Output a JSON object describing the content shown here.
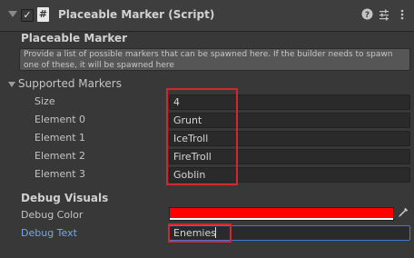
{
  "header": {
    "enabled_check": "✓",
    "script_icon": "#",
    "title": "Placeable Marker (Script)",
    "icons": [
      "help-icon",
      "presets-icon",
      "more-options-icon"
    ]
  },
  "intro": {
    "title": "Placeable Marker",
    "help_text": "Provide a list of possible markers that can be spawned here.  If the builder needs to spawn one of these, it will be spawned here"
  },
  "supported_markers": {
    "label": "Supported Markers",
    "size_label": "Size",
    "size_value": "4",
    "elements": [
      {
        "label": "Element 0",
        "value": "Grunt"
      },
      {
        "label": "Element 1",
        "value": "IceTroll"
      },
      {
        "label": "Element 2",
        "value": "FireTroll"
      },
      {
        "label": "Element 3",
        "value": "Goblin"
      }
    ]
  },
  "debug": {
    "section_title": "Debug Visuals",
    "color_label": "Debug Color",
    "color_value": "#ff0000",
    "text_label": "Debug Text",
    "text_value": "Enemies"
  },
  "colors": {
    "highlight_box": "#d1272d",
    "focus_border": "#3e7ad6",
    "active_label": "#7aa7e0"
  }
}
